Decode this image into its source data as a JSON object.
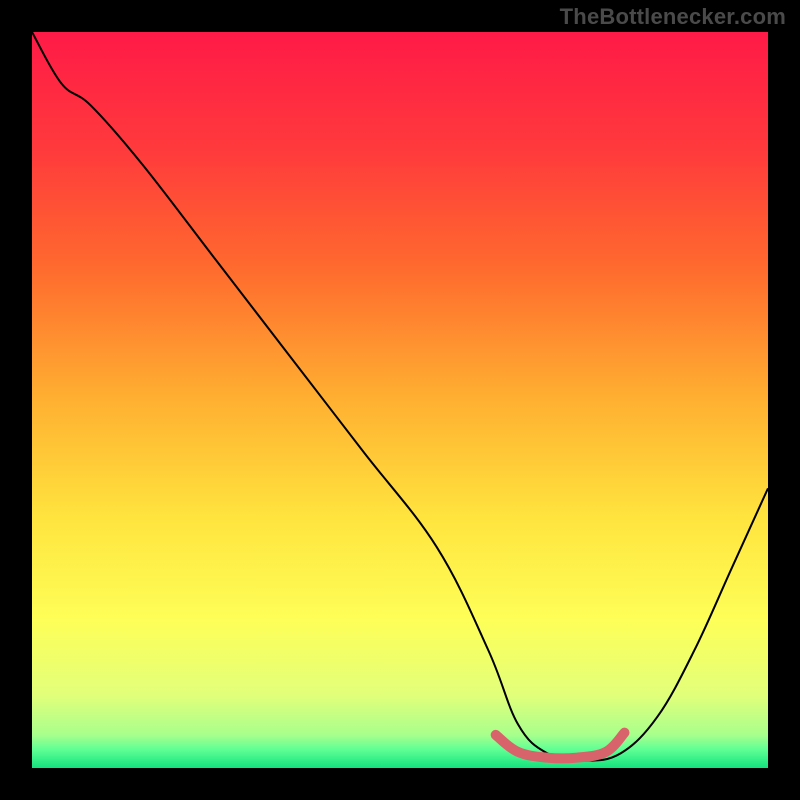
{
  "watermark": "TheBottlenecker.com",
  "chart_data": {
    "type": "line",
    "title": "",
    "xlabel": "",
    "ylabel": "",
    "xlim": [
      0,
      100
    ],
    "ylim": [
      0,
      100
    ],
    "grid": false,
    "legend": false,
    "background_gradient": {
      "stops": [
        {
          "offset": 0.0,
          "color": "#ff1a47"
        },
        {
          "offset": 0.16,
          "color": "#ff3a3c"
        },
        {
          "offset": 0.32,
          "color": "#ff6a2e"
        },
        {
          "offset": 0.5,
          "color": "#ffb031"
        },
        {
          "offset": 0.66,
          "color": "#ffe43e"
        },
        {
          "offset": 0.8,
          "color": "#feff58"
        },
        {
          "offset": 0.9,
          "color": "#e2ff7a"
        },
        {
          "offset": 0.955,
          "color": "#a8ff8c"
        },
        {
          "offset": 0.975,
          "color": "#5fff94"
        },
        {
          "offset": 1.0,
          "color": "#14e27d"
        }
      ]
    },
    "series": [
      {
        "name": "bottleneck-curve",
        "stroke": "#000000",
        "stroke_width": 2,
        "x": [
          0,
          4,
          8,
          15,
          25,
          35,
          45,
          55,
          62,
          66,
          70,
          75,
          80,
          85,
          90,
          95,
          100
        ],
        "y": [
          100,
          93,
          90,
          82,
          69,
          56,
          43,
          30,
          16,
          6,
          2,
          1,
          2,
          7,
          16,
          27,
          38
        ]
      },
      {
        "name": "optimal-range-marker",
        "stroke": "#d9636a",
        "stroke_width": 10,
        "linecap": "round",
        "x": [
          63,
          66,
          70,
          74,
          78,
          80.5
        ],
        "y": [
          4.5,
          2.2,
          1.4,
          1.4,
          2.2,
          4.8
        ]
      }
    ]
  }
}
